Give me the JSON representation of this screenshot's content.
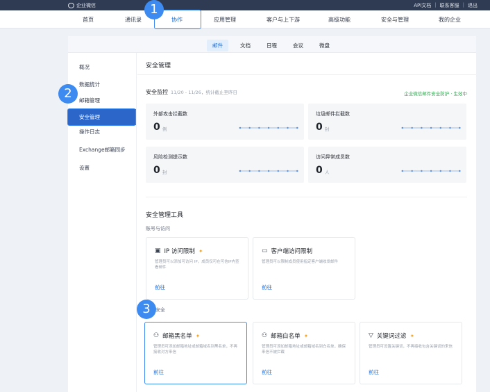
{
  "topbar": {
    "brand": "企业微信",
    "links": [
      "API文档",
      "联系客服",
      "退出"
    ]
  },
  "mainnav": {
    "items": [
      "首页",
      "通讯录",
      "协作",
      "应用管理",
      "客户与上下游",
      "高级功能",
      "安全与管理",
      "我的企业"
    ],
    "active": "协作"
  },
  "annotations": {
    "step1": "1",
    "step2": "2",
    "step3": "3"
  },
  "subtabs": {
    "items": [
      "邮件",
      "文档",
      "日程",
      "会议",
      "微盘"
    ],
    "active": "邮件"
  },
  "sidebar": {
    "items": [
      "概况",
      "数据统计",
      "邮箱管理",
      "安全管理",
      "操作日志",
      "Exchange邮箱同步",
      "设置"
    ],
    "active": "安全管理"
  },
  "content": {
    "title": "安全管理",
    "monitor": {
      "label": "安全监控",
      "range": "11/20 - 11/26，统计截止至昨日",
      "link": "企业微信邮件安全防护 · 生效中"
    },
    "stats": [
      {
        "title": "外部攻击拦截数",
        "value": "0",
        "unit": "例"
      },
      {
        "title": "垃圾邮件拦截数",
        "value": "0",
        "unit": "封"
      },
      {
        "title": "风险检测提示数",
        "value": "0",
        "unit": "封"
      },
      {
        "title": "访问异常成员数",
        "value": "0",
        "unit": "人"
      }
    ],
    "tools_title": "安全管理工具",
    "group1": "账号与访问",
    "group2": "邮件安全",
    "cards": [
      {
        "title": "IP 访问限制",
        "desc": "管理员可以添加可访问 IP，成员仅可在可信IP内查看邮件",
        "action": "前往",
        "icon": "ip-icon"
      },
      {
        "title": "客户端访问限制",
        "desc": "管理员可以限制成员使用指定客户端收发邮件",
        "action": "前往",
        "icon": "monitor-icon"
      },
      {
        "title": "邮箱黑名单",
        "desc": "管理员可添加邮箱地址或邮箱域名到黑名单，不再接收对方来信",
        "action": "前往",
        "icon": "user-block-icon"
      },
      {
        "title": "邮箱白名单",
        "desc": "管理员可添加邮箱地址或邮箱域名到白名单，确保来信不被拦截",
        "action": "前往",
        "icon": "user-allow-icon"
      },
      {
        "title": "关键词过滤",
        "desc": "管理员可设置关键词，不再接收包含关键词的来信",
        "action": "前往",
        "icon": "filter-icon"
      }
    ]
  },
  "colors": {
    "accent": "#1e6fd9",
    "annotation": "#3d8bf0",
    "topbar": "#2f3b53",
    "sidebar_active": "#2c66c9",
    "status_green": "#34a853"
  }
}
